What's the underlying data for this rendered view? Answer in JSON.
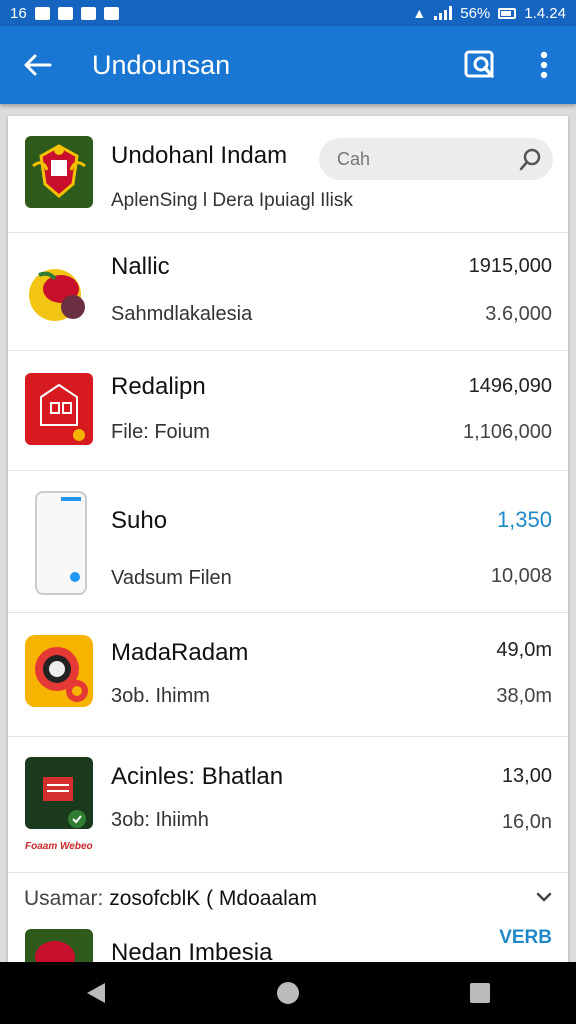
{
  "status_bar": {
    "left_text": "16",
    "time": "1.4.24",
    "battery": "56%"
  },
  "app_bar": {
    "title": "Undounsan"
  },
  "header": {
    "title": "Undohanl Indam",
    "subtitle": "AplenSing l Dera Ipuiagl Ilisk",
    "search": {
      "placeholder": "Cah"
    }
  },
  "rows": [
    {
      "title": "Nallic",
      "subtitle": "Sahmdlakalesia",
      "value_primary": "1915,000",
      "value_secondary": "3.6,000"
    },
    {
      "title": "Redalipn",
      "subtitle": "File: Foium",
      "value_primary": "1496,090",
      "value_secondary": "1,106,000"
    },
    {
      "title": "Suho",
      "subtitle": "Vadsum Filen",
      "value_primary": "1,350",
      "value_secondary": "10,008",
      "highlight_color": "#1e88c8"
    },
    {
      "title": "MadaRadam",
      "subtitle": "3ob. Ihimm",
      "value_primary": "49,0m",
      "value_secondary": "38,0m"
    },
    {
      "title": "Acinles: Bhatlan",
      "subtitle": "3ob: Ihiimh",
      "value_primary": "13,00",
      "value_secondary": "16,0n",
      "icon_caption": "Foaam Webeo"
    }
  ],
  "footer": {
    "label": "Usamar:",
    "value": "zosofcblK ( Mdoaalam",
    "peek_title": "Nedan Imbesia",
    "peek_badge": "VERB"
  },
  "colors": {
    "app_bar": "#1976d2",
    "status_bar": "#1565c0",
    "accent": "#1e88c8"
  },
  "icons": [
    "back-arrow-icon",
    "search-document-icon",
    "more-vert-icon",
    "search-icon",
    "chevron-down-icon",
    "nav-back-icon",
    "nav-home-icon",
    "nav-recents-icon"
  ]
}
